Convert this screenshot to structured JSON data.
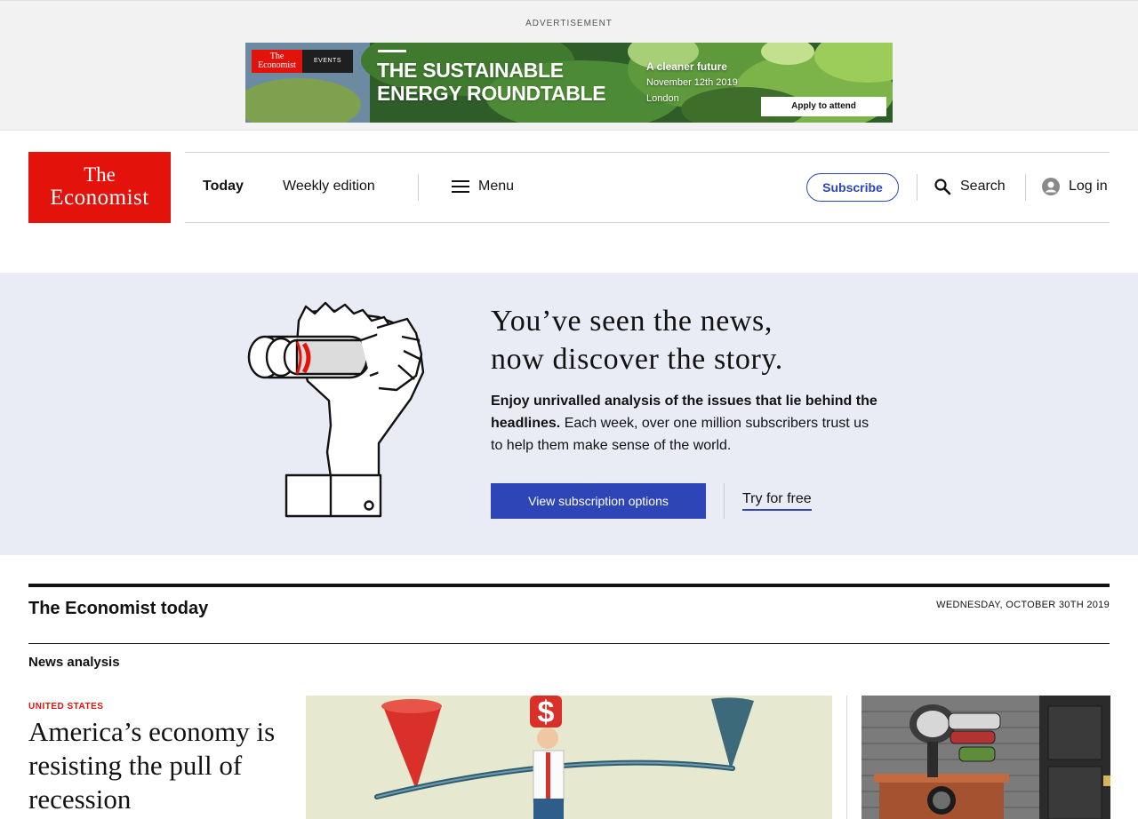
{
  "ad": {
    "label": "ADVERTISEMENT",
    "logo_line1": "The",
    "logo_line2": "Economist",
    "logo_events": "EVENTS",
    "title_line1": "THE SUSTAINABLE",
    "title_line2": "ENERGY ROUNDTABLE",
    "tagline": "A cleaner future",
    "date": "November 12th 2019",
    "location": "London",
    "button": "Apply to attend"
  },
  "header": {
    "logo_line1": "The",
    "logo_line2": "Economist",
    "nav_today": "Today",
    "nav_weekly": "Weekly edition",
    "nav_menu": "Menu",
    "subscribe": "Subscribe",
    "search": "Search",
    "login": "Log in"
  },
  "promo": {
    "headline_line1": "You’ve seen the news,",
    "headline_line2": "now discover the story.",
    "body_bold": "Enjoy unrivalled analysis of the issues that lie behind the headlines.",
    "body_rest": " Each week, over one million subscribers trust us to help them make sense of the world.",
    "cta": "View subscription options",
    "try": "Try for free"
  },
  "today": {
    "title": "The Economist today",
    "date": "WEDNESDAY, OCTOBER 30TH 2019",
    "section": "News analysis",
    "lead_kicker": "UNITED STATES",
    "lead_headline": "America’s economy is resisting the pull of recession"
  },
  "colors": {
    "brand_red": "#e3120b",
    "accent_blue": "#2e45b8",
    "promo_bg": "#e9ecf5"
  }
}
